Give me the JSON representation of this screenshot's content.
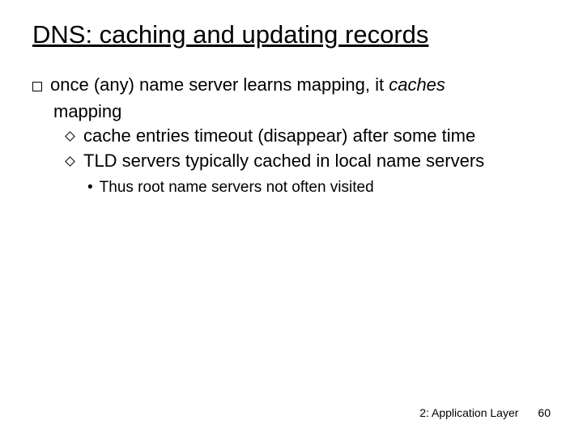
{
  "title": "DNS: caching and updating records",
  "bullets": {
    "l1_part1": "once (any) name server learns mapping, it ",
    "l1_caches": "caches",
    "l1_cont": "mapping",
    "l2_a": "cache entries timeout (disappear) after some time",
    "l2_b": "TLD servers typically cached in local name servers",
    "l3_a": "Thus root name servers not often visited"
  },
  "footer": {
    "section": "2: Application Layer",
    "page": "60"
  }
}
